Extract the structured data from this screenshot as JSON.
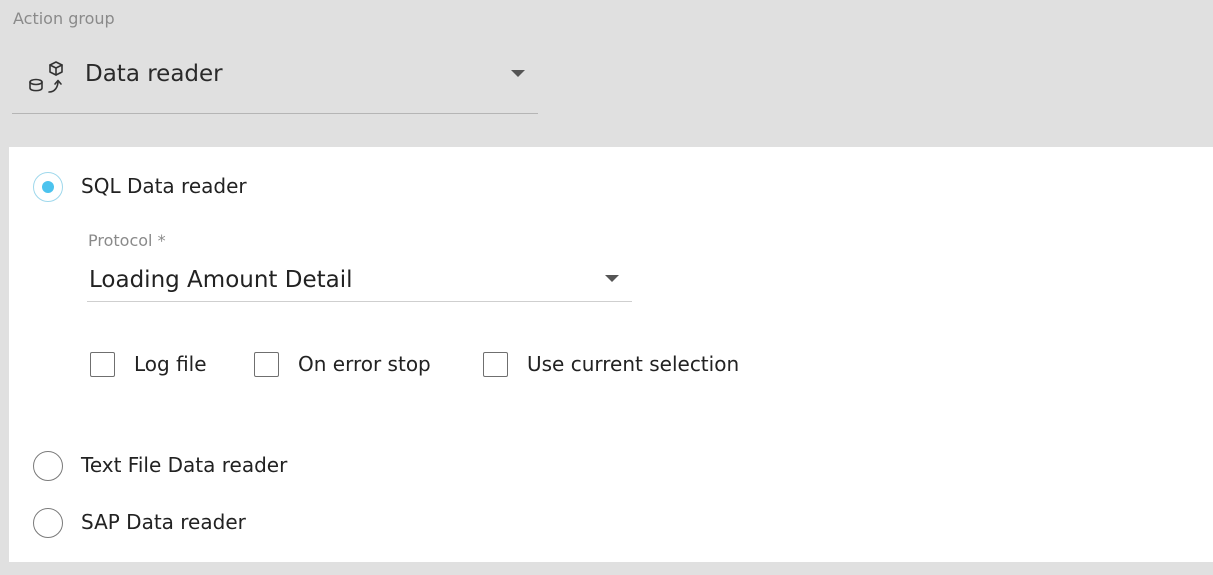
{
  "action_group": {
    "label": "Action group",
    "value": "Data reader",
    "icon": "data-reader-icon"
  },
  "reader_options": [
    {
      "label": "SQL Data reader",
      "selected": true
    },
    {
      "label": "Text File Data reader",
      "selected": false
    },
    {
      "label": "SAP Data reader",
      "selected": false
    }
  ],
  "protocol": {
    "label": "Protocol *",
    "value": "Loading Amount Detail"
  },
  "checkboxes": [
    {
      "label": "Log file",
      "checked": false
    },
    {
      "label": "On error stop",
      "checked": false
    },
    {
      "label": "Use current selection",
      "checked": false
    }
  ],
  "colors": {
    "background": "#e0e0e0",
    "panel": "#ffffff",
    "radio_accent": "#4cc3ee",
    "muted_text": "#8a8a8a"
  }
}
